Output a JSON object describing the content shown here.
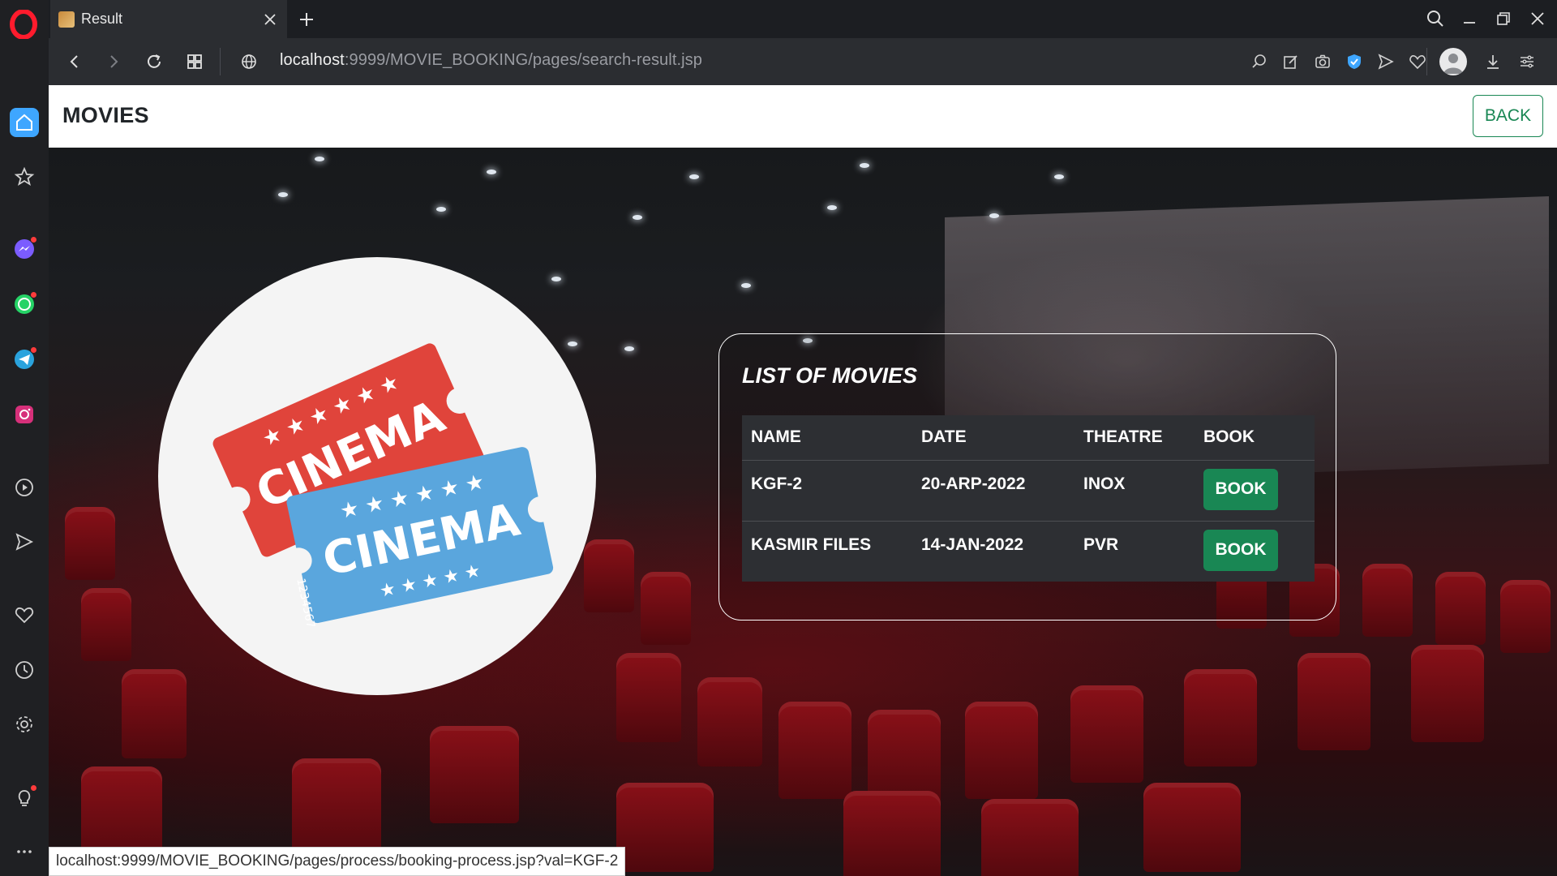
{
  "browser": {
    "tab_title": "Result",
    "url_host": "localhost",
    "url_rest": ":9999/MOVIE_BOOKING/pages/search-result.jsp",
    "status_url": "localhost:9999/MOVIE_BOOKING/pages/process/booking-process.jsp?val=KGF-2",
    "sidebar_icons": [
      "home-icon",
      "star-icon",
      "messenger-icon",
      "whatsapp-icon",
      "telegram-icon",
      "instagram-icon",
      "player-icon",
      "send-icon",
      "heart-icon",
      "history-icon",
      "settings-icon",
      "bulb-icon",
      "more-icon"
    ]
  },
  "navbar": {
    "brand": "MOVIES",
    "back_label": "BACK"
  },
  "logo": {
    "red_ticket_text": "CINEMA",
    "blue_ticket_text": "CINEMA",
    "ticket_number": "1234567",
    "colors": {
      "red": "#e0443b",
      "blue": "#5aa6dd"
    }
  },
  "card": {
    "title": "LIST OF MOVIES",
    "columns": [
      "NAME",
      "DATE",
      "THEATRE",
      "BOOK"
    ],
    "rows": [
      {
        "name": "KGF-2",
        "date": "20-ARP-2022",
        "theatre": "INOX",
        "book_label": "BOOK"
      },
      {
        "name": "KASMIR FILES",
        "date": "14-JAN-2022",
        "theatre": "PVR",
        "book_label": "BOOK"
      }
    ]
  },
  "colors": {
    "accent": "#198754",
    "table_bg": "#2d2f33"
  }
}
